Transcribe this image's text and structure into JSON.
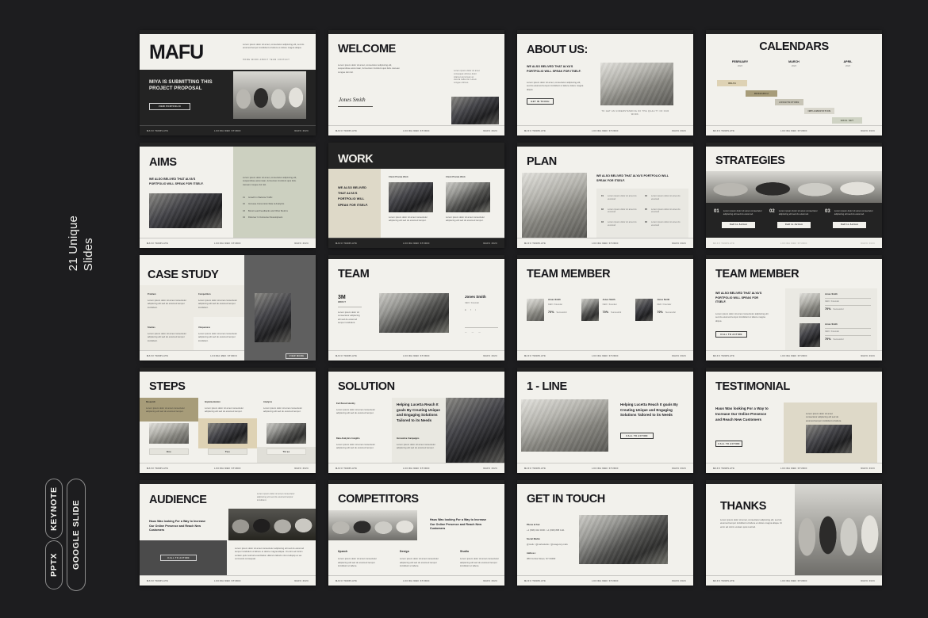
{
  "page": {
    "background_color": "#1d1d1f",
    "unique_slides_label": "21 Unique\nSlides",
    "badges": [
      {
        "id": "pptx",
        "label": "PPTX"
      },
      {
        "id": "keynote",
        "label": "KEYNOTE"
      },
      {
        "id": "google-slide",
        "label": "GOOGLE SLIDE"
      }
    ]
  },
  "theme": {
    "paper": "#f2f1ec",
    "ink": "#16161a",
    "dark_panel": "#232323",
    "sage": "#ccd0c0",
    "sand": "#ded2b4",
    "beige": "#ded9c8",
    "gray_panel": "#5f5f5f"
  },
  "footer": {
    "left": "MAFU TEMPLATE",
    "center": "LUCIDA MBC STUDIO",
    "right": "MAFU 2023"
  },
  "slides": [
    {
      "n": 1,
      "name": "cover",
      "title": "MAFU",
      "headline": "MIYA IS SUBMITTING THIS PROJECT PROPOSAL",
      "body": "Lorem ipsum dolor sit amet, consectetur adipiscing elit, sed do eiusmod tempor incididunt ut labore et dolore magna aliqua.",
      "nav": "HOME   WORK   ABOUT   TEAM   CONTACT",
      "button": "VIEW PORTFOLIO"
    },
    {
      "n": 2,
      "name": "welcome",
      "title": "WELCOME",
      "body": "Lorem ipsum dolor sit amet, consectetur adipiscing elit, suspendisse accumsan, fermentum tincidunt quis felis. Aenean congue dui nisl.",
      "side_note": "Lorem ipsum dolor sit amet consequat ultrices dolor sitamet accumsan ac viverra nulla nisi. Lorem congue ultrices.",
      "signature": "Jones Smith"
    },
    {
      "n": 3,
      "name": "about-us",
      "title": "ABOUT US:",
      "subtitle": "WE ALSO BELIVED THAT ALYA'S PORTFOLIO WILL SPEAK FOR ITSELF.",
      "body": "Lorem ipsum dolor sit amet, consectetur adipiscing elit, sed do eiusmod tempor incididunt ut labore dolore magna aliqua.",
      "button": "GET IN TOUCH",
      "caption": "TO GET AN UNDERSTANDING OF THE QUALITY OF OUR WORK."
    },
    {
      "n": 4,
      "name": "calendars",
      "title": "CALENDARS",
      "months": [
        {
          "label": "FEBRUARY",
          "sub": "2023"
        },
        {
          "label": "MARCH",
          "sub": "2023"
        },
        {
          "label": "APRIL",
          "sub": "2023"
        }
      ],
      "bars": [
        {
          "label": "IDEAS",
          "color": "#ded2b4"
        },
        {
          "label": "RESEARCH",
          "color": "#a79c79"
        },
        {
          "label": "ARCHITECTURE",
          "color": "#c7c4b6"
        },
        {
          "label": "IMPLEMENTATION",
          "color": "#d8d6cc"
        },
        {
          "label": "GOAL SET",
          "color": "#cfd3c4"
        }
      ]
    },
    {
      "n": 5,
      "name": "aims",
      "title": "AIMS",
      "subtitle": "WE ALSO BELIVED THAT ALYA'S PORTFOLIO WILL SPEAK FOR ITSELF.",
      "body": "Lorem ipsum dolor sit amet, consectetur adipiscing elit, suspendisse accumsan, fermentum tincidunt quis felis. Aenean congue dui nisl.",
      "list": [
        {
          "num": "01",
          "text": "Growth In Website Traffic"
        },
        {
          "num": "02",
          "text": "Increase Conversion Rate & Analytics"
        },
        {
          "num": "03",
          "text": "Boost Lead Feedbacks and Other Metrics"
        },
        {
          "num": "04",
          "text": "Discover In Consumer Development"
        }
      ]
    },
    {
      "n": 6,
      "name": "work",
      "title": "WORK",
      "side_text": "WE ALSO BELIVED THAT ALYA'S PORTFOLIO WILL SPEAK FOR ITSELF.",
      "cards": [
        {
          "label": "Client Private Work",
          "body": "Lorem ipsum dolor sit amet consectetur adipiscing elit sed do eiusmod tempor."
        },
        {
          "label": "Client Private Work",
          "body": "Lorem ipsum dolor sit amet consectetur adipiscing elit sed do eiusmod tempor."
        }
      ]
    },
    {
      "n": 7,
      "name": "plan",
      "title": "PLAN",
      "subtitle": "WE ALSO BELIVED THAT ALYA'S PORTFOLIO WILL SPEAK FOR ITSELF.",
      "items": [
        {
          "num": "01",
          "text": "Lorem ipsum dolor sit amet do eiusmod"
        },
        {
          "num": "02",
          "text": "Lorem ipsum dolor sit amet do eiusmod"
        },
        {
          "num": "03",
          "text": "Lorem ipsum dolor sit amet do eiusmod"
        },
        {
          "num": "04",
          "text": "Lorem ipsum dolor sit amet do eiusmod"
        },
        {
          "num": "05",
          "text": "Lorem ipsum dolor sit amet do eiusmod"
        },
        {
          "num": "06",
          "text": "Lorem ipsum dolor sit amet do eiusmod"
        }
      ]
    },
    {
      "n": 8,
      "name": "strategies",
      "title": "STRATEGIES",
      "items": [
        {
          "num": "01",
          "text": "Lorem ipsum dolor sit amet consectetur adipiscing elit sed do eiusmod.",
          "button": "Call to Action"
        },
        {
          "num": "02",
          "text": "Lorem ipsum dolor sit amet consectetur adipiscing elit sed do eiusmod.",
          "button": "Call to Action"
        },
        {
          "num": "03",
          "text": "Lorem ipsum dolor sit amet consectetur adipiscing elit sed do eiusmod.",
          "button": "Call to Action"
        }
      ]
    },
    {
      "n": 9,
      "name": "case-study",
      "title": "CASE STUDY",
      "cells": [
        {
          "label": "Problem",
          "body": "Lorem ipsum dolor sit amet consectetur adipiscing elit sed do eiusmod tempor incididunt."
        },
        {
          "label": "Competition",
          "body": "Lorem ipsum dolor sit amet consectetur adipiscing elit sed do eiusmod tempor incididunt."
        },
        {
          "label": "Studies",
          "body": "Lorem ipsum dolor sit amet consectetur adipiscing elit sed do eiusmod tempor incididunt."
        },
        {
          "label": "Uniqueness",
          "body": "Lorem ipsum dolor sit amet consectetur adipiscing elit sed do eiusmod tempor incididunt."
        }
      ],
      "button": "VIEW MORE"
    },
    {
      "n": 10,
      "name": "team",
      "title": "TEAM",
      "stat_value": "3M",
      "stat_label": "IMPACT",
      "left_list": "Lorem ipsum dolor sit consectetur adipiscing elit sed do eiusmod tempor incididunt.",
      "person": "Jones Smith",
      "person_role": "CEO / Founder",
      "socials": [
        "in",
        "f",
        "t"
      ]
    },
    {
      "n": 11,
      "name": "team-member-grid",
      "title": "TEAM MEMBER",
      "members": [
        {
          "name": "Jones Smith",
          "role": "CEO / Founder",
          "stat": "70%",
          "stat_label": "Successful"
        },
        {
          "name": "Jones Smith",
          "role": "CEO / Founder",
          "stat": "70%",
          "stat_label": "Successful"
        },
        {
          "name": "Jones Smith",
          "role": "CEO / Founder",
          "stat": "70%",
          "stat_label": "Successful"
        }
      ]
    },
    {
      "n": 12,
      "name": "team-member-list",
      "title": "TEAM MEMBER",
      "subtitle": "WE ALSO BELIVED THAT ALYA'S PORTFOLIO WILL SPEAK FOR ITSELF.",
      "body": "Lorem ipsum dolor sit amet consectetur adipiscing elit sed do eiusmod tempor incididunt ut labore magna aliqua.",
      "button": "CALL TO ACTION",
      "members": [
        {
          "name": "Jones Smith",
          "role": "CEO / Founder",
          "stat": "70%",
          "stat_label": "Successful"
        },
        {
          "name": "Jones Smith",
          "role": "CEO / Founder",
          "stat": "70%",
          "stat_label": "Successful"
        }
      ]
    },
    {
      "n": 13,
      "name": "steps",
      "title": "STEPS",
      "columns": [
        {
          "label": "Research",
          "body": "Lorem ipsum dolor sit amet consectetur adipiscing elit sed do eiusmod tempor.",
          "button": "One",
          "accent": "#a79c79"
        },
        {
          "label": "Implementation",
          "body": "Lorem ipsum dolor sit amet consectetur adipiscing elit sed do eiusmod tempor.",
          "button": "Two",
          "accent": "#ded2b4"
        },
        {
          "label": "Analysis",
          "body": "Lorem ipsum dolor sit amet consectetur adipiscing elit sed do eiusmod tempor.",
          "button": "Three",
          "accent": "#e0dfd8"
        }
      ]
    },
    {
      "n": 14,
      "name": "solution",
      "title": "SOLUTION",
      "headline": "Helping Lucetta Reach It goals By Creating Unique and Engaging Solutions Tailored to its Needs",
      "cells": [
        {
          "label": "Full Brand Identity",
          "body": "Lorem ipsum dolor sit amet consectetur adipiscing elit sed do eiusmod tempor."
        },
        {
          "label": "Data Analytics Insights",
          "body": "Lorem ipsum dolor sit amet consectetur adipiscing elit sed do eiusmod tempor."
        },
        {
          "label": "Innovative Campaigns",
          "body": "Lorem ipsum dolor sit amet consectetur adipiscing elit sed do eiusmod tempor."
        }
      ]
    },
    {
      "n": 15,
      "name": "one-line",
      "title": "1 - LINE",
      "headline": "Helping Lucetta Reach It goals By Creating Unique and Engaging Solutions Tailored to its Needs",
      "button": "CALL TO ACTION"
    },
    {
      "n": 16,
      "name": "testimonial",
      "title": "TESTIMONIAL",
      "headline": "Haus Was looking For a Way to Increase Our Online Presence and Reach New Customers",
      "button": "CALL TO ACTION",
      "quote": "Lorem ipsum dolor sit amet consectetur adipiscing elit sed do eiusmod tempor incididunt ut labore."
    },
    {
      "n": 17,
      "name": "audience",
      "title": "AUDIENCE",
      "headline": "Haus Was looking For a Way to Increase Our Online Presence and Reach New Customers",
      "note": "Lorem ipsum dolor sit amet consectetur adipiscing elit sed do eiusmod tempor incididunt.",
      "body": "Lorem ipsum dolor sit amet consectetur adipiscing elit sed do eiusmod tempor incididunt ut labore et dolore magna aliqua. Ut enim ad minim veniam quis nostrud exercitation ullamco laboris nisi ut aliquip ex ea commodo consequat.",
      "button": "CALL TO ACTION"
    },
    {
      "n": 18,
      "name": "competitors",
      "title": "COMPETITORS",
      "headline": "Haus Was looking For a Way to Increase Our Online Presence and Reach New Customers",
      "columns": [
        {
          "label": "Uparch",
          "body": "Lorem ipsum dolor sit amet consectetur adipiscing elit sed do eiusmod tempor incididunt ut labore."
        },
        {
          "label": "Design",
          "body": "Lorem ipsum dolor sit amet consectetur adipiscing elit sed do eiusmod tempor incididunt ut labore."
        },
        {
          "label": "Studio",
          "body": "Lorem ipsum dolor sit amet consectetur adipiscing elit sed do eiusmod tempor incididunt ut labore."
        }
      ]
    },
    {
      "n": 19,
      "name": "get-in-touch",
      "title": "GET IN TOUCH",
      "contacts": [
        {
          "label": "Phone & Fax:",
          "value": "+1 (838) 342 0000 / +1 (838) 888 1111"
        },
        {
          "label": "Social Media:",
          "value": "@mafu / @mafustudio / @uxagency.mafu"
        },
        {
          "label": "Address:",
          "value": "380 Curtiss Street, NY 00482"
        }
      ]
    },
    {
      "n": 20,
      "name": "thanks",
      "title": "THANKS",
      "body": "Lorem ipsum dolor sit amet, consectetur adipiscing elit, sed do eiusmod tempor incididunt ut labore et dolore magna aliqua. Ut enim ad minim veniam quis nostrud."
    }
  ]
}
